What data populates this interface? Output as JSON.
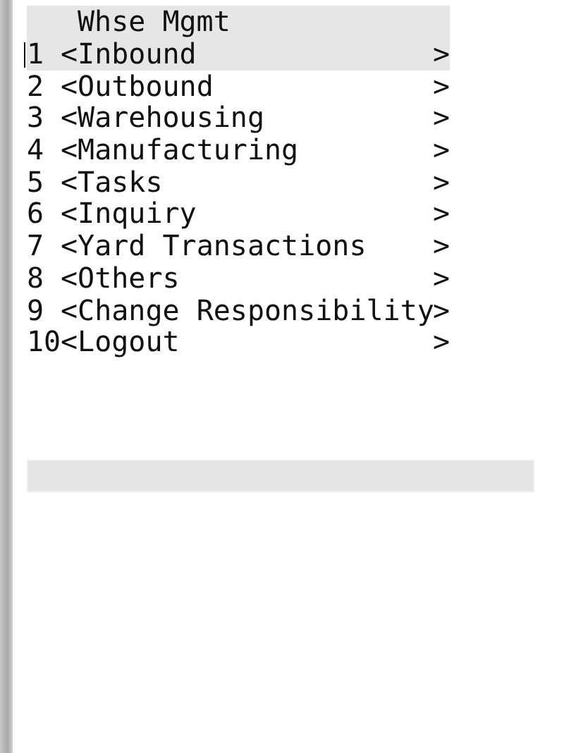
{
  "title": "Whse Mgmt",
  "menu": [
    {
      "number": "1",
      "label": "<Inbound",
      "arrow": ">",
      "selected": true
    },
    {
      "number": "2",
      "label": "<Outbound",
      "arrow": ">",
      "selected": false
    },
    {
      "number": "3",
      "label": "<Warehousing",
      "arrow": ">",
      "selected": false
    },
    {
      "number": "4",
      "label": "<Manufacturing",
      "arrow": ">",
      "selected": false
    },
    {
      "number": "5",
      "label": "<Tasks",
      "arrow": ">",
      "selected": false
    },
    {
      "number": "6",
      "label": "<Inquiry",
      "arrow": ">",
      "selected": false
    },
    {
      "number": "7",
      "label": "<Yard Transactions",
      "arrow": ">",
      "selected": false
    },
    {
      "number": "8",
      "label": "<Others",
      "arrow": ">",
      "selected": false
    },
    {
      "number": "9",
      "label": "<Change Responsibility",
      "arrow": ">",
      "selected": false
    },
    {
      "number": "10",
      "label": "<Logout",
      "arrow": ">",
      "selected": false
    }
  ]
}
